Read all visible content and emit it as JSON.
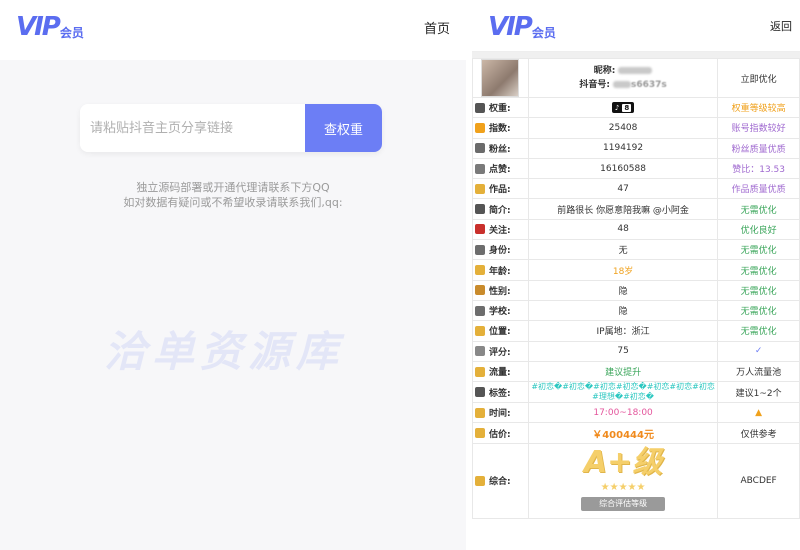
{
  "left": {
    "logo_vip": "VIP",
    "logo_hy": "会员",
    "nav_home": "首页",
    "search_placeholder": "请粘贴抖音主页分享链接",
    "search_button": "查权重",
    "notice_line1": "独立源码部署或开通代理请联系下方QQ",
    "notice_line2": "如对数据有疑问或不希望收录请联系我们,qq:",
    "watermark": "洽单资源库"
  },
  "right": {
    "logo_vip": "VIP",
    "logo_hy": "会员",
    "back": "返回",
    "profile": {
      "nickname_label": "昵称:",
      "douyin_label": "抖音号:",
      "douyin_partial": "s6637s",
      "action": "立即优化"
    },
    "rows": [
      {
        "label": "权重:",
        "value": "8",
        "note": "权重等级较高",
        "icon_color": "#555555",
        "note_color": "orange"
      },
      {
        "label": "指数:",
        "value": "25408",
        "note": "账号指数较好",
        "icon_color": "#f0a11c",
        "note_color": "purple"
      },
      {
        "label": "粉丝:",
        "value": "1194192",
        "note": "粉丝质量优质",
        "icon_color": "#6b6b6b",
        "note_color": "purple"
      },
      {
        "label": "点赞:",
        "value": "16160588",
        "note": "赞比：13.53",
        "icon_color": "#7a7a7a",
        "note_color": "purple"
      },
      {
        "label": "作品:",
        "value": "47",
        "note": "作品质量优质",
        "icon_color": "#e4b03a",
        "note_color": "purple"
      },
      {
        "label": "简介:",
        "value": "前路很长 你愿意陪我嘛 @小阿金",
        "note": "无需优化",
        "icon_color": "#555555",
        "note_color": "green"
      },
      {
        "label": "关注:",
        "value": "48",
        "note": "优化良好",
        "icon_color": "#c9302c",
        "note_color": "green"
      },
      {
        "label": "身份:",
        "value": "无",
        "note": "无需优化",
        "icon_color": "#6d6d6d",
        "note_color": "green"
      },
      {
        "label": "年龄:",
        "value": "18岁",
        "note": "无需优化",
        "icon_color": "#e4b03a",
        "note_color": "green",
        "value_color": "orange"
      },
      {
        "label": "性别:",
        "value": "隐",
        "note": "无需优化",
        "icon_color": "#c98b2c",
        "note_color": "green"
      },
      {
        "label": "学校:",
        "value": "隐",
        "note": "无需优化",
        "icon_color": "#6d6d6d",
        "note_color": "green"
      },
      {
        "label": "位置:",
        "value": "IP属地：浙江",
        "note": "无需优化",
        "icon_color": "#e4b03a",
        "note_color": "green"
      },
      {
        "label": "评分:",
        "value": "75",
        "note": "✓",
        "icon_color": "#888888",
        "note_color": "violet"
      },
      {
        "label": "流量:",
        "value": "建议提升",
        "note": "万人流量池",
        "icon_color": "#e4b03a",
        "note_color": "",
        "value_color": "green"
      },
      {
        "label": "时间:",
        "value": "17:00~18:00",
        "note": "▲",
        "icon_color": "#e4b03a",
        "note_color": "orange",
        "value_color": "pink"
      },
      {
        "label": "估价:",
        "value": "￥400444元",
        "note": "仅供参考",
        "icon_color": "#e4b03a",
        "note_color": "",
        "value_color": "red-orange"
      }
    ],
    "tags": {
      "label": "标签:",
      "value": "#初恋�#初恋�#初恋#初恋�#初恋#初恋#初恋#理想�#初恋�",
      "note": "建议1~2个"
    },
    "summary": {
      "label": "综合:",
      "grade": "A+级",
      "stars": "★★★★★",
      "ribbon": "综合评估等级",
      "note": "ABCDEF"
    }
  }
}
